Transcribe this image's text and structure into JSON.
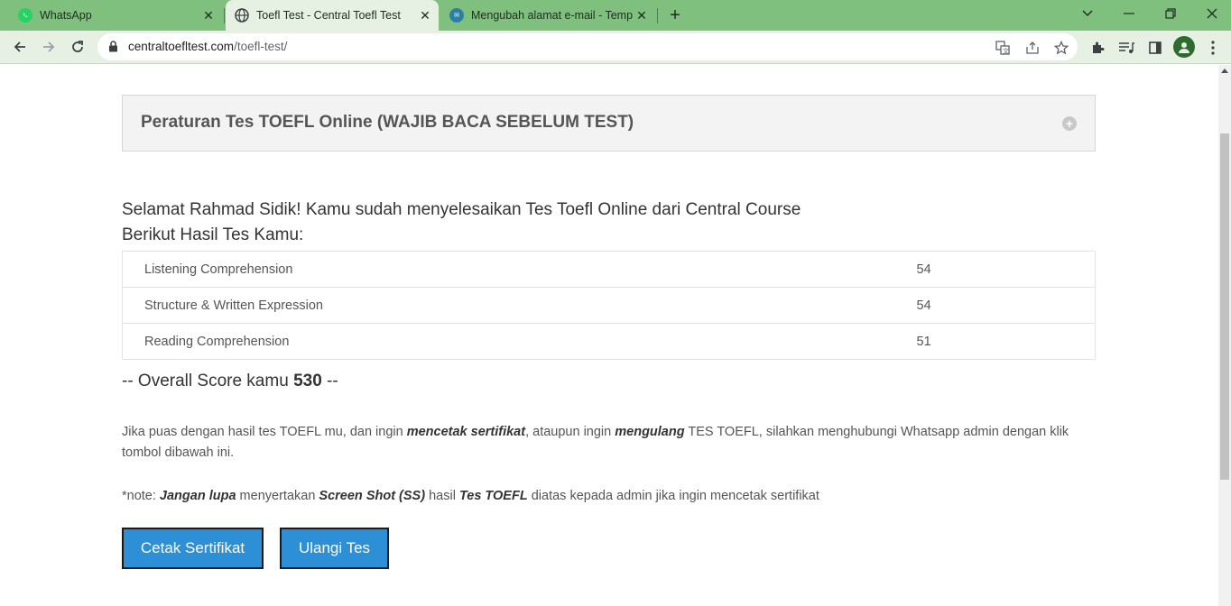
{
  "browser": {
    "tabs": [
      {
        "title": "WhatsApp",
        "favicon": "whatsapp-icon"
      },
      {
        "title": "Toefl Test - Central Toefl Test",
        "favicon": "globe-icon"
      },
      {
        "title": "Mengubah alamat e-mail - Temp",
        "favicon": "site-icon"
      }
    ],
    "url_domain": "centraltoefltest.com",
    "url_path": "/toefl-test/"
  },
  "page": {
    "accordion_title": "Peraturan Tes TOEFL Online (WAJIB BACA SEBELUM TEST)",
    "greeting_line1": "Selamat Rahmad Sidik! Kamu sudah menyelesaikan Tes Toefl Online dari Central Course",
    "greeting_line2": "Berikut Hasil Tes Kamu:",
    "results": [
      {
        "section": "Listening Comprehension",
        "score": "54"
      },
      {
        "section": "Structure & Written Expression",
        "score": "54"
      },
      {
        "section": "Reading Comprehension",
        "score": "51"
      }
    ],
    "overall_prefix": "-- Overall Score kamu",
    "overall_score": "530",
    "overall_suffix": "--",
    "info": {
      "t1": "Jika puas dengan hasil tes TOEFL mu, dan ingin ",
      "b1": "mencetak sertifikat",
      "t2": ", ataupun ingin ",
      "b2": "mengulang",
      "t3": " TES TOEFL, silahkan menghubungi Whatsapp admin dengan klik tombol dibawah ini."
    },
    "note": {
      "t1": "*note: ",
      "b1": "Jangan lupa",
      "t2": " menyertakan ",
      "b2": "Screen Shot (SS)",
      "t3": " hasil ",
      "b3": "Tes TOEFL",
      "t4": " diatas kepada admin jika ingin mencetak sertifikat"
    },
    "buttons": {
      "print": "Cetak Sertifikat",
      "retry": "Ulangi Tes"
    }
  },
  "colors": {
    "tabstrip": "#7fc07e",
    "toolbar": "#e6f0e3",
    "button": "#2d8fd6"
  }
}
